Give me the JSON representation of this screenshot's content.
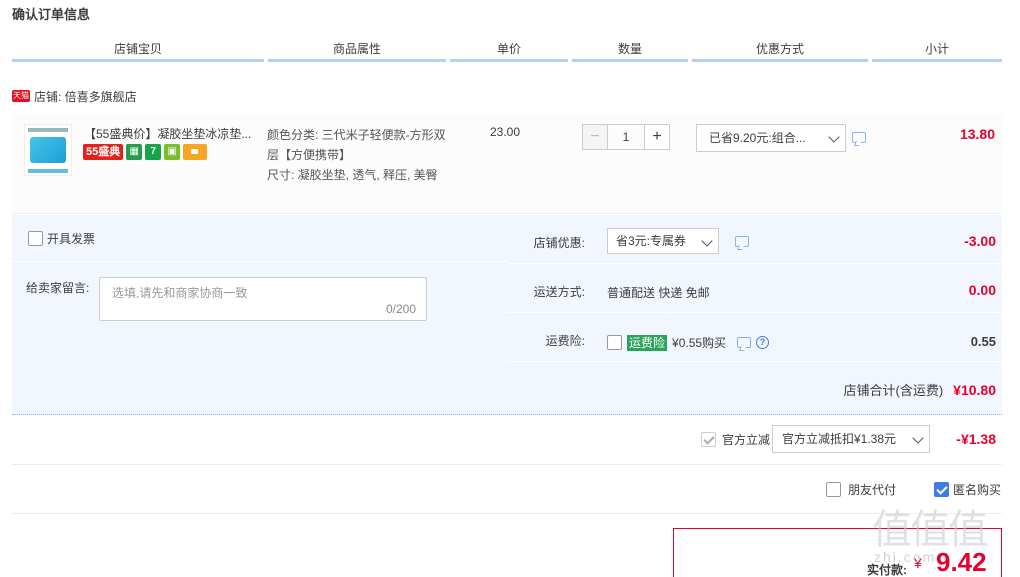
{
  "page_title": "确认订单信息",
  "columns": [
    "店铺宝贝",
    "商品属性",
    "单价",
    "数量",
    "优惠方式",
    "小计"
  ],
  "shop": {
    "badge": "天猫",
    "label": "店铺: 倍喜多旗舰店"
  },
  "item": {
    "title": "【55盛典价】凝胶坐垫冰凉垫...",
    "promo_badge": "55盛典",
    "promo_icons": [
      "gift-icon",
      "seven-day-icon",
      "guarantee-icon",
      "card-icon"
    ],
    "seven_label": "7",
    "attrs": {
      "color": "颜色分类: 三代米子轻便款-方形双层【方便携带】",
      "size": "尺寸: 凝胶坐垫, 透气, 释压, 美臀"
    },
    "unit_price": "23.00",
    "quantity": "1",
    "qty_minus": "−",
    "qty_plus": "+",
    "discount": "已省9.20元:组合...",
    "subtotal": "13.80"
  },
  "invoice": {
    "label": "开具发票"
  },
  "message": {
    "label": "给卖家留言:",
    "placeholder": "选填,请先和商家协商一致",
    "count": "0/200"
  },
  "shop_coupon": {
    "label": "店铺优惠:",
    "select": "省3元:专属券",
    "amount": "-3.00"
  },
  "shipping": {
    "label": "运送方式:",
    "value": "普通配送 快递 免邮",
    "amount": "0.00"
  },
  "insurance": {
    "label": "运费险:",
    "tag": "运费险",
    "price": "¥0.55购买",
    "help": "?",
    "amount": "0.55"
  },
  "shop_total": {
    "label": "店铺合计(含运费)",
    "amount": "¥10.80"
  },
  "official": {
    "label": "官方立减",
    "select": "官方立减抵扣¥1.38元",
    "amount": "-¥1.38"
  },
  "options": {
    "friend_pay": "朋友代付",
    "anonymous": "匿名购买"
  },
  "payment": {
    "label": "实付款:",
    "currency": "¥",
    "amount": "9.42"
  },
  "watermark": {
    "glyphs": "值值值",
    "text": "zhi.com"
  },
  "colors": {
    "accent_red": "#e5002d",
    "header_line": "#b2d1ff",
    "panel_bg": "#f2f7ff",
    "tmall_red": "#e40e1d"
  }
}
